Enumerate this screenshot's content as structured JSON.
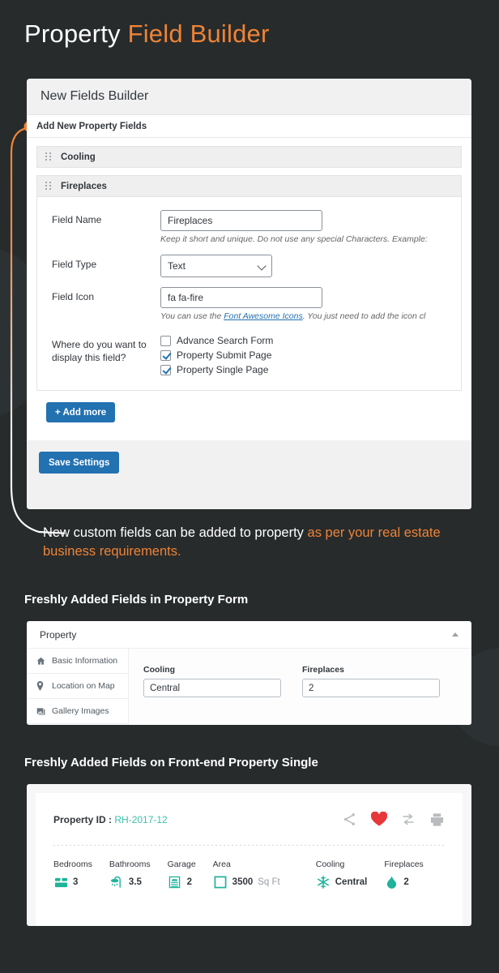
{
  "page": {
    "title_plain": "Property ",
    "title_accent": "Field Builder"
  },
  "builder": {
    "card_title": "New Fields Builder",
    "section_title": "Add New Property Fields",
    "rows": [
      {
        "label": "Cooling"
      },
      {
        "label": "Fireplaces"
      }
    ],
    "form": {
      "field_name_label": "Field Name",
      "field_name_value": "Fireplaces",
      "field_name_hint": "Keep it short and unique. Do not use any special Characters. Example:",
      "field_type_label": "Field Type",
      "field_type_value": "Text",
      "field_type_options": [
        "Text"
      ],
      "field_icon_label": "Field Icon",
      "field_icon_value": "fa fa-fire",
      "field_icon_hint_pre": "You can use the ",
      "field_icon_hint_link": "Font Awesome Icons",
      "field_icon_hint_post": ". You just need to add the icon cl",
      "display_label": "Where do you want to display this field?",
      "display_options": [
        {
          "label": "Advance Search Form",
          "checked": false
        },
        {
          "label": "Property Submit Page",
          "checked": true
        },
        {
          "label": "Property Single Page",
          "checked": true
        }
      ]
    },
    "add_more_label": "+ Add more",
    "save_label": "Save Settings"
  },
  "caption": {
    "plain": "New custom fields can be added to property ",
    "accent": "as per your real estate business requirements."
  },
  "sections": {
    "form_heading": "Freshly Added Fields in Property Form",
    "single_heading": "Freshly Added Fields on Front-end Property Single"
  },
  "property_form": {
    "card_title": "Property",
    "tabs": [
      {
        "label": "Basic Information",
        "icon": "home-icon"
      },
      {
        "label": "Location on Map",
        "icon": "map-pin-icon"
      },
      {
        "label": "Gallery Images",
        "icon": "images-icon"
      }
    ],
    "fields": [
      {
        "label": "Cooling",
        "value": "Central"
      },
      {
        "label": "Fireplaces",
        "value": "2"
      }
    ]
  },
  "property_single": {
    "id_label": "Property ID : ",
    "id_value": "RH-2017-12",
    "actions": [
      {
        "name": "share-icon"
      },
      {
        "name": "favorite-heart-icon"
      },
      {
        "name": "compare-icon"
      },
      {
        "name": "print-icon"
      }
    ],
    "specs": [
      {
        "label": "Bedrooms",
        "value": "3",
        "unit": "",
        "icon": "bed-icon"
      },
      {
        "label": "Bathrooms",
        "value": "3.5",
        "unit": "",
        "icon": "shower-icon"
      },
      {
        "label": "Garage",
        "value": "2",
        "unit": "",
        "icon": "garage-icon"
      },
      {
        "label": "Area",
        "value": "3500",
        "unit": "Sq Ft",
        "icon": "area-icon"
      },
      {
        "label": "Cooling",
        "value": "Central",
        "unit": "",
        "icon": "snowflake-icon"
      },
      {
        "label": "Fireplaces",
        "value": "2",
        "unit": "",
        "icon": "fire-icon"
      }
    ]
  },
  "colors": {
    "background": "#272b2c",
    "accent_orange": "#ef8335",
    "accent_blue": "#2271b1",
    "accent_teal": "#1fb39a",
    "id_teal": "#3ac1a8",
    "heart_red": "#e8373b"
  }
}
